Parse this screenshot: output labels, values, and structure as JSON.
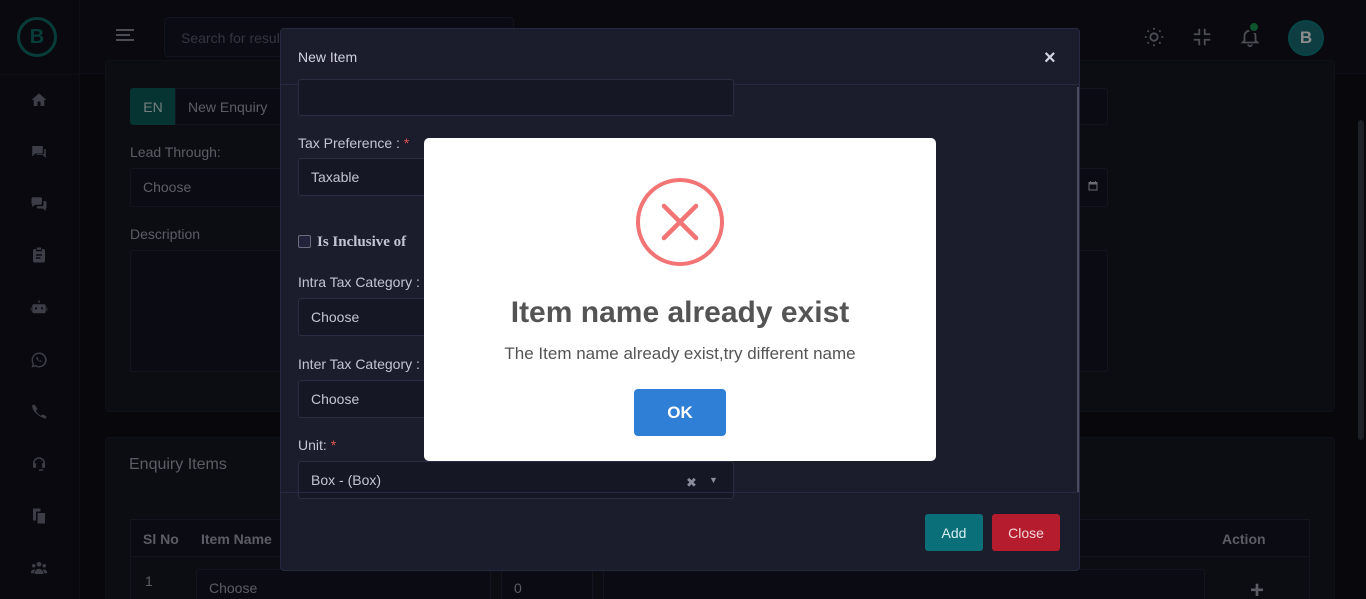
{
  "header": {
    "search_placeholder": "Search for results...",
    "avatar_letter": "B",
    "logo_letter": "B"
  },
  "sidebar": {
    "items": [
      {
        "icon": "home-icon"
      },
      {
        "icon": "chat-window-icon"
      },
      {
        "icon": "comments-icon"
      },
      {
        "icon": "clipboard-icon"
      },
      {
        "icon": "robot-icon"
      },
      {
        "icon": "whatsapp-icon"
      },
      {
        "icon": "phone-icon"
      },
      {
        "icon": "headset-icon"
      },
      {
        "icon": "copy-icon"
      },
      {
        "icon": "users-icon"
      }
    ]
  },
  "background": {
    "lang_code": "EN",
    "enquiry_name": "New Enquiry",
    "lead_through_label": "Lead Through:",
    "lead_through_value": "Choose",
    "description_label": "Description",
    "items_title": "Enquiry Items",
    "table_headers": [
      "Sl No",
      "Item Name",
      "Action"
    ],
    "row_index": "1",
    "row_item": "Choose",
    "row_qty": "0"
  },
  "modal": {
    "title": "New Item",
    "close_symbol": "×",
    "tax_preference_label": "Tax Preference :",
    "tax_preference_value": "Taxable",
    "inclusive_label": "Is Inclusive of",
    "intra_tax_label": "Intra Tax Category :",
    "intra_tax_value": "Choose",
    "inter_tax_label": "Inter Tax Category :",
    "inter_tax_value": "Choose",
    "unit_label": "Unit:",
    "unit_value": "Box - (Box)",
    "required_mark": "*",
    "add_label": "Add",
    "close_label": "Close"
  },
  "alert": {
    "title": "Item name already exist",
    "text": "The Item name already exist,try different name",
    "ok_label": "OK",
    "icon": "error-x-icon",
    "icon_color": "#f27474"
  },
  "colors": {
    "accent_teal": "#0b6f7a",
    "danger_red": "#b51d2e",
    "ok_blue": "#2f7fd6"
  }
}
